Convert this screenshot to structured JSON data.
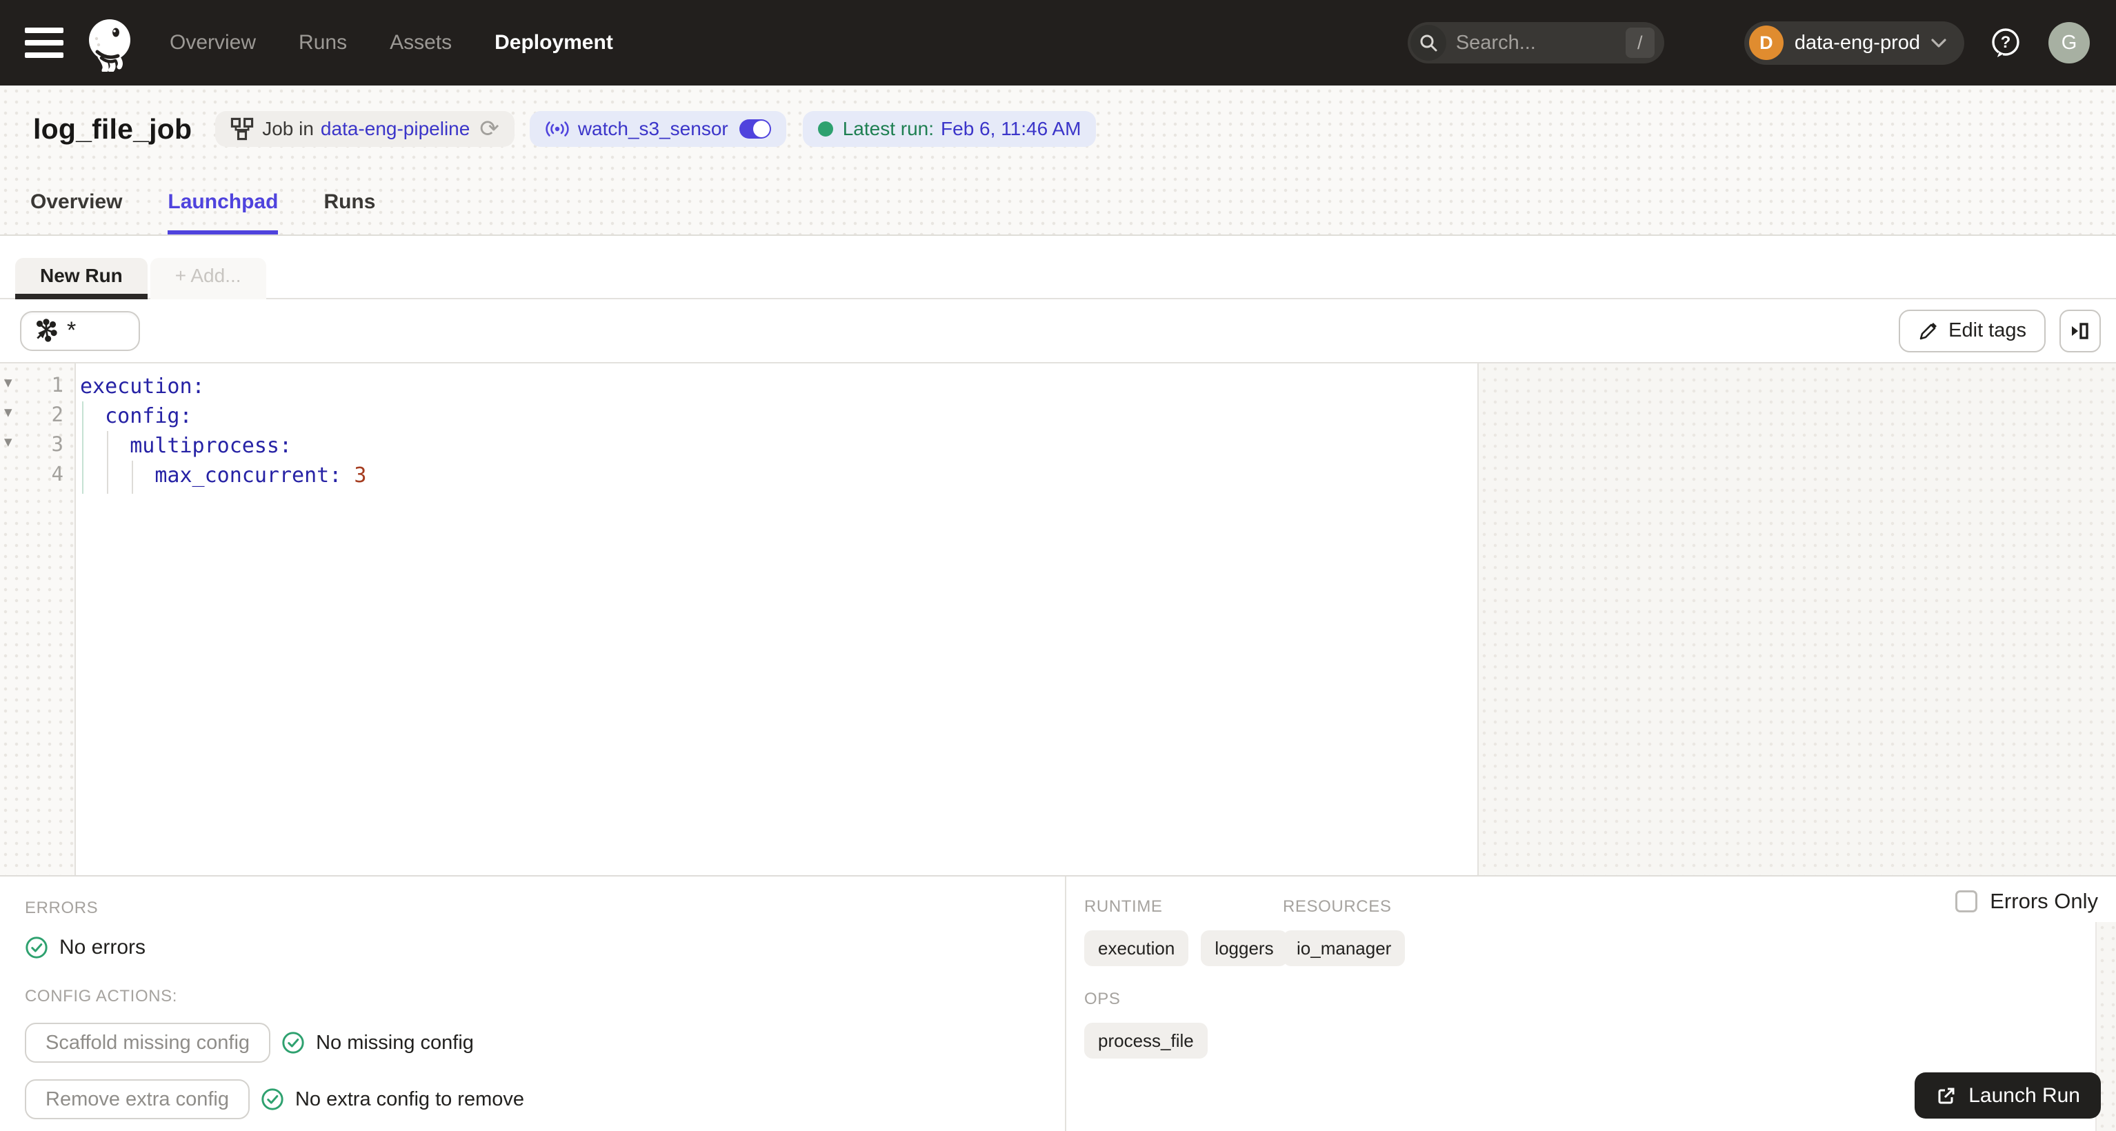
{
  "colors": {
    "accent": "#4F43DD",
    "link": "#3B35C9",
    "green_text": "#1E7F51",
    "green_icon": "#2EA16F",
    "yaml_key": "#2622A5",
    "yaml_value": "#A53D20",
    "header_bg": "#221F1D",
    "org_orange": "#E08C2F"
  },
  "icons": [
    "hamburger-icon",
    "dagster-logo",
    "search-icon",
    "chevron-down-icon",
    "help-icon",
    "workflow-icon",
    "refresh-icon",
    "sensor-icon",
    "toggle-switch",
    "pencil-icon",
    "panel-expand-icon",
    "op-selector-icon",
    "check-circle-icon",
    "launch-icon",
    "fold-arrow"
  ],
  "header": {
    "nav": [
      {
        "label": "Overview"
      },
      {
        "label": "Runs"
      },
      {
        "label": "Assets"
      },
      {
        "label": "Deployment",
        "active": true
      }
    ],
    "search": {
      "placeholder": "Search...",
      "shortcut": "/"
    },
    "org": {
      "initial": "D",
      "name": "data-eng-prod"
    },
    "avatar_initial": "G"
  },
  "title_bar": {
    "title": "log_file_job",
    "job_pill": {
      "prefix": "Job in",
      "link": "data-eng-pipeline",
      "refresh_glyph": "⟳"
    },
    "sensor_pill": {
      "name": "watch_s3_sensor"
    },
    "latest_run": {
      "label": "Latest run:",
      "value": "Feb 6, 11:46 AM"
    }
  },
  "tabs": [
    {
      "label": "Overview"
    },
    {
      "label": "Launchpad",
      "active": true
    },
    {
      "label": "Runs"
    }
  ],
  "session_tabs": {
    "active": "New Run",
    "add": "+ Add..."
  },
  "toolbar": {
    "op_selector_value": "*",
    "edit_tags_label": "Edit tags"
  },
  "editor": {
    "lines": [
      {
        "num": "1",
        "fold": "▾",
        "key": "execution:",
        "value": ""
      },
      {
        "num": "2",
        "fold": "▾",
        "key": "  config:",
        "value": ""
      },
      {
        "num": "3",
        "fold": "▾",
        "key": "    multiprocess:",
        "value": ""
      },
      {
        "num": "4",
        "fold": "",
        "key": "      max_concurrent:",
        "value": " 3"
      }
    ]
  },
  "bottom_left": {
    "errors_label": "ERRORS",
    "no_errors": "No errors",
    "config_actions_label": "CONFIG ACTIONS:",
    "scaffold_button": "Scaffold missing config",
    "scaffold_status": "No missing config",
    "remove_button": "Remove extra config",
    "remove_status": "No extra config to remove"
  },
  "bottom_right": {
    "errors_only_label": "Errors Only",
    "sections": [
      {
        "title": "RUNTIME",
        "tags": [
          "execution",
          "loggers"
        ]
      },
      {
        "title": "RESOURCES",
        "tags": [
          "io_manager"
        ]
      },
      {
        "title": "OPS",
        "tags": [
          "process_file"
        ]
      }
    ],
    "launch_button": "Launch Run"
  }
}
